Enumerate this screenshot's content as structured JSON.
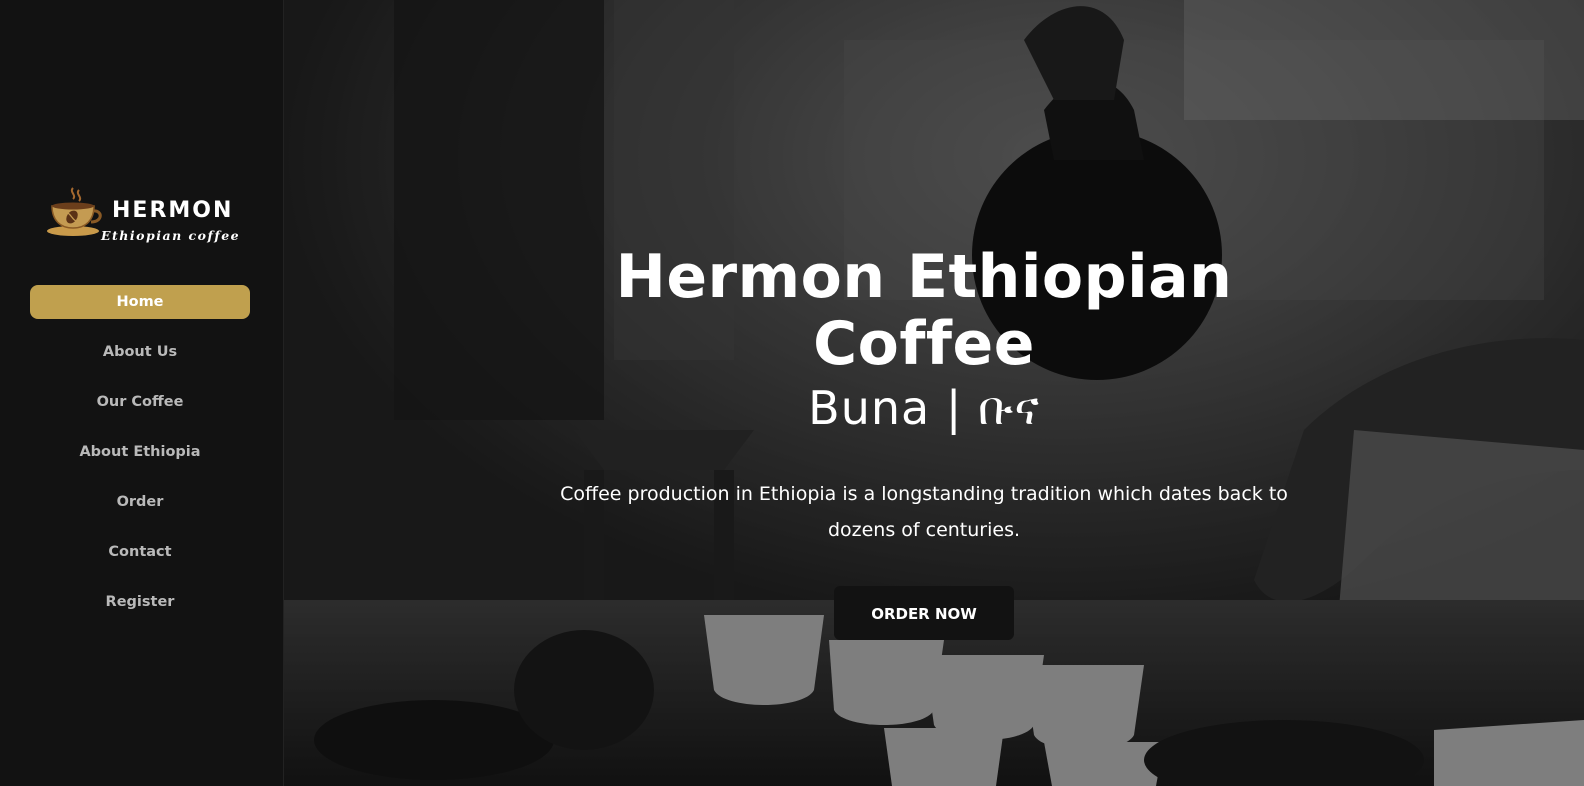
{
  "brand": {
    "name": "HERMON",
    "tagline": "Ethiopian coffee",
    "logo_icon": "coffee-cup-icon",
    "accent_color": "#c0a04e"
  },
  "nav": {
    "items": [
      {
        "label": "Home",
        "active": true
      },
      {
        "label": "About Us",
        "active": false
      },
      {
        "label": "Our Coffee",
        "active": false
      },
      {
        "label": "About Ethiopia",
        "active": false
      },
      {
        "label": "Order",
        "active": false
      },
      {
        "label": "Contact",
        "active": false
      },
      {
        "label": "Register",
        "active": false
      }
    ]
  },
  "hero": {
    "title": "Hermon Ethiopian Coffee",
    "subtitle": "Buna | ቡና",
    "description": "Coffee production in Ethiopia is a longstanding tradition which dates back to dozens of centuries.",
    "cta_label": "ORDER NOW"
  }
}
